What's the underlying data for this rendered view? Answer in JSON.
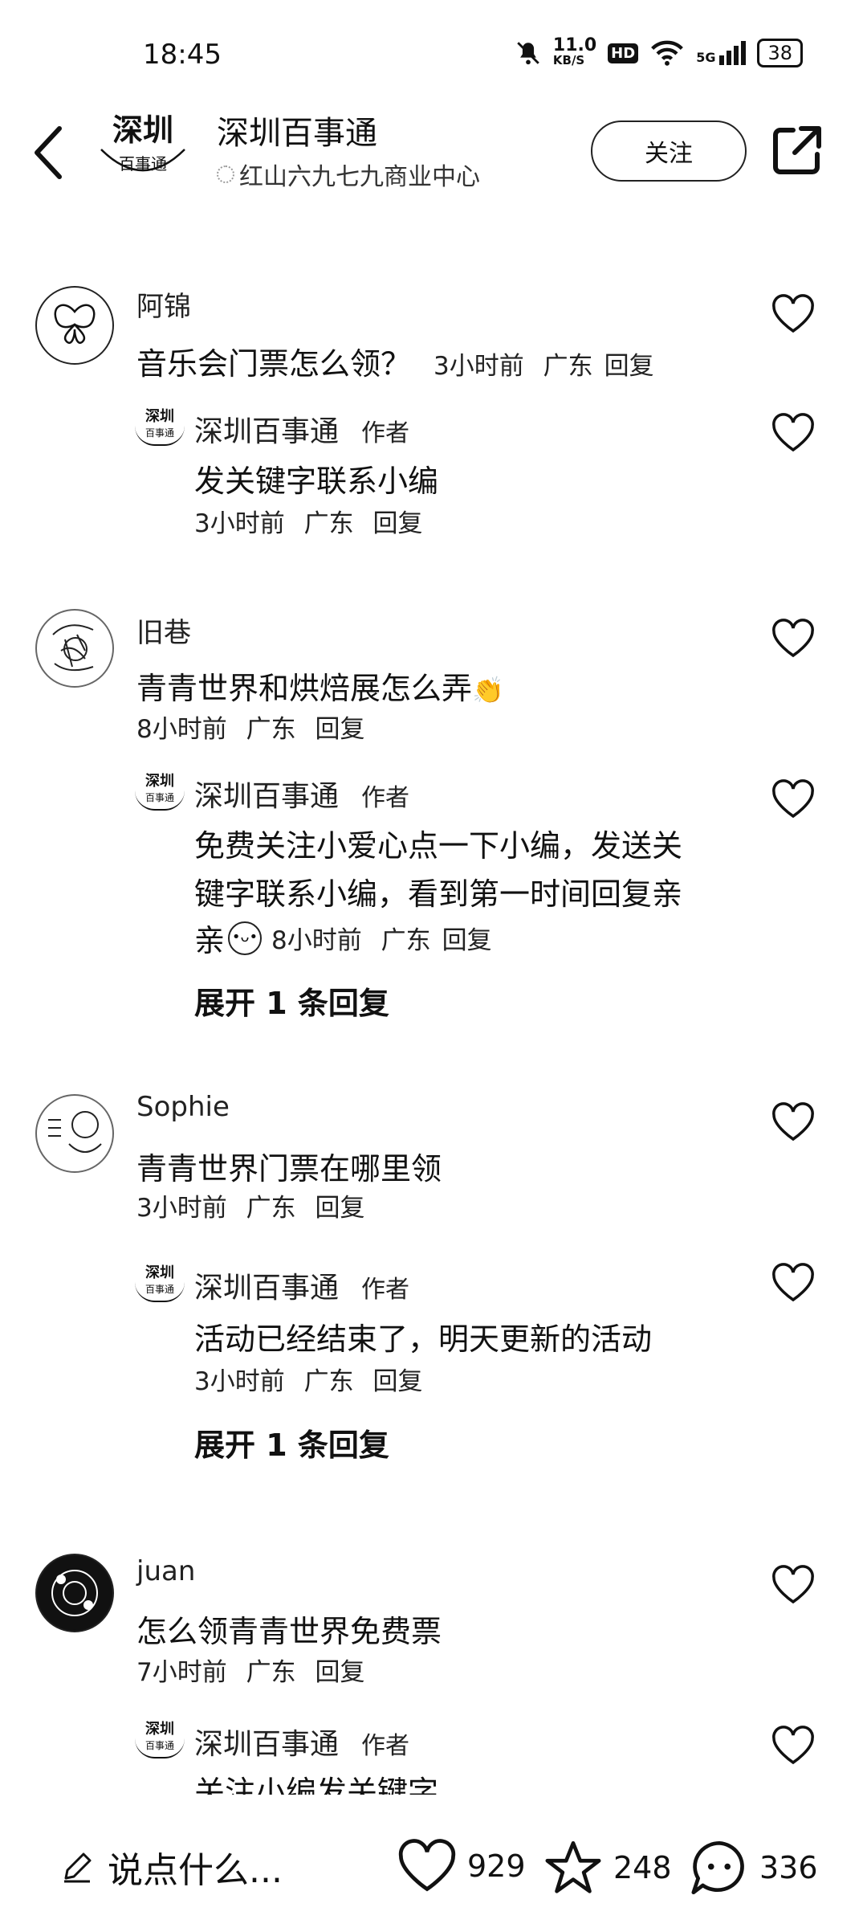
{
  "status_bar": {
    "time": "18:45",
    "net_speed": "11.0",
    "net_unit": "KB/S",
    "hd": "HD",
    "signal": "5G",
    "battery": "38"
  },
  "header": {
    "account_name": "深圳百事通",
    "location": "红山六九七九商业中心",
    "logo_text_top": "深圳",
    "logo_text_bottom": "百事通",
    "follow_label": "关注"
  },
  "comments": [
    {
      "user": "阿锦",
      "text": "音乐会门票怎么领？",
      "meta_time": "3小时前",
      "meta_region": "广东",
      "reply_label": "回复",
      "author_reply": {
        "name": "深圳百事通",
        "tag": "作者",
        "text": "发关键字联系小编",
        "time": "3小时前",
        "region": "广东",
        "reply_label": "回复"
      }
    },
    {
      "user": "旧巷",
      "text": "青青世界和烘焙展怎么弄",
      "meta_time": "8小时前",
      "meta_region": "广东",
      "reply_label": "回复",
      "author_reply": {
        "name": "深圳百事通",
        "tag": "作者",
        "text_line1": "免费关注小爱心点一下小编，发送关",
        "text_line2": "键字联系小编，看到第一时间回复亲",
        "text_line3": "亲",
        "time": "8小时前",
        "region": "广东",
        "reply_label": "回复"
      },
      "expand_label": "展开 1 条回复"
    },
    {
      "user": "Sophie",
      "text": "青青世界门票在哪里领",
      "meta_time": "3小时前",
      "meta_region": "广东",
      "reply_label": "回复",
      "author_reply": {
        "name": "深圳百事通",
        "tag": "作者",
        "text": "活动已经结束了，明天更新的活动",
        "time": "3小时前",
        "region": "广东",
        "reply_label": "回复"
      },
      "expand_label": "展开 1 条回复"
    },
    {
      "user": "juan",
      "text": "怎么领青青世界免费票",
      "meta_time": "7小时前",
      "meta_region": "广东",
      "reply_label": "回复",
      "author_reply": {
        "name": "深圳百事通",
        "tag": "作者",
        "text": "关注小编发关键字"
      }
    }
  ],
  "bottom_bar": {
    "say_placeholder": "说点什么...",
    "likes": "929",
    "favorites": "248",
    "comments": "336"
  }
}
